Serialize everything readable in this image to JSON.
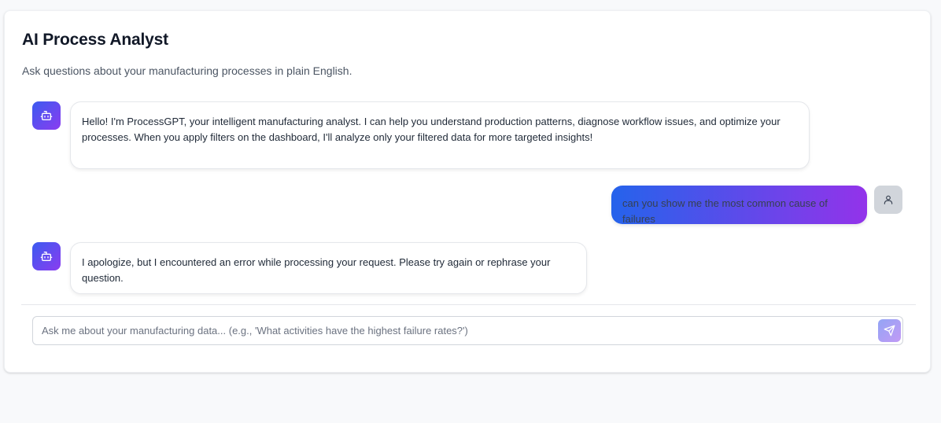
{
  "header": {
    "title": "AI Process Analyst",
    "subtitle": "Ask questions about your manufacturing processes in plain English."
  },
  "messages": [
    {
      "role": "assistant",
      "avatar_icon": "robot-icon",
      "lines": [
        "Hello! I'm ProcessGPT, your intelligent manufacturing analyst. I can help you understand production patterns, diagnose workflow issues, and optimize your",
        "processes. When you apply filters on the dashboard, I'll analyze only your filtered data for more targeted insights!"
      ]
    },
    {
      "role": "user",
      "avatar_icon": "user-icon",
      "lines": [
        "can you show me the most common cause of failures"
      ]
    },
    {
      "role": "assistant",
      "avatar_icon": "robot-icon",
      "lines": [
        "I apologize, but I encountered an error while processing your request. Please try again or rephrase your question."
      ]
    }
  ],
  "composer": {
    "value": "",
    "placeholder": "Ask me about your manufacturing data... (e.g., 'What activities have the highest failure rates?')",
    "send_icon": "send-icon"
  },
  "colors": {
    "accent_start": "#2563eb",
    "accent_end": "#9333ea"
  }
}
